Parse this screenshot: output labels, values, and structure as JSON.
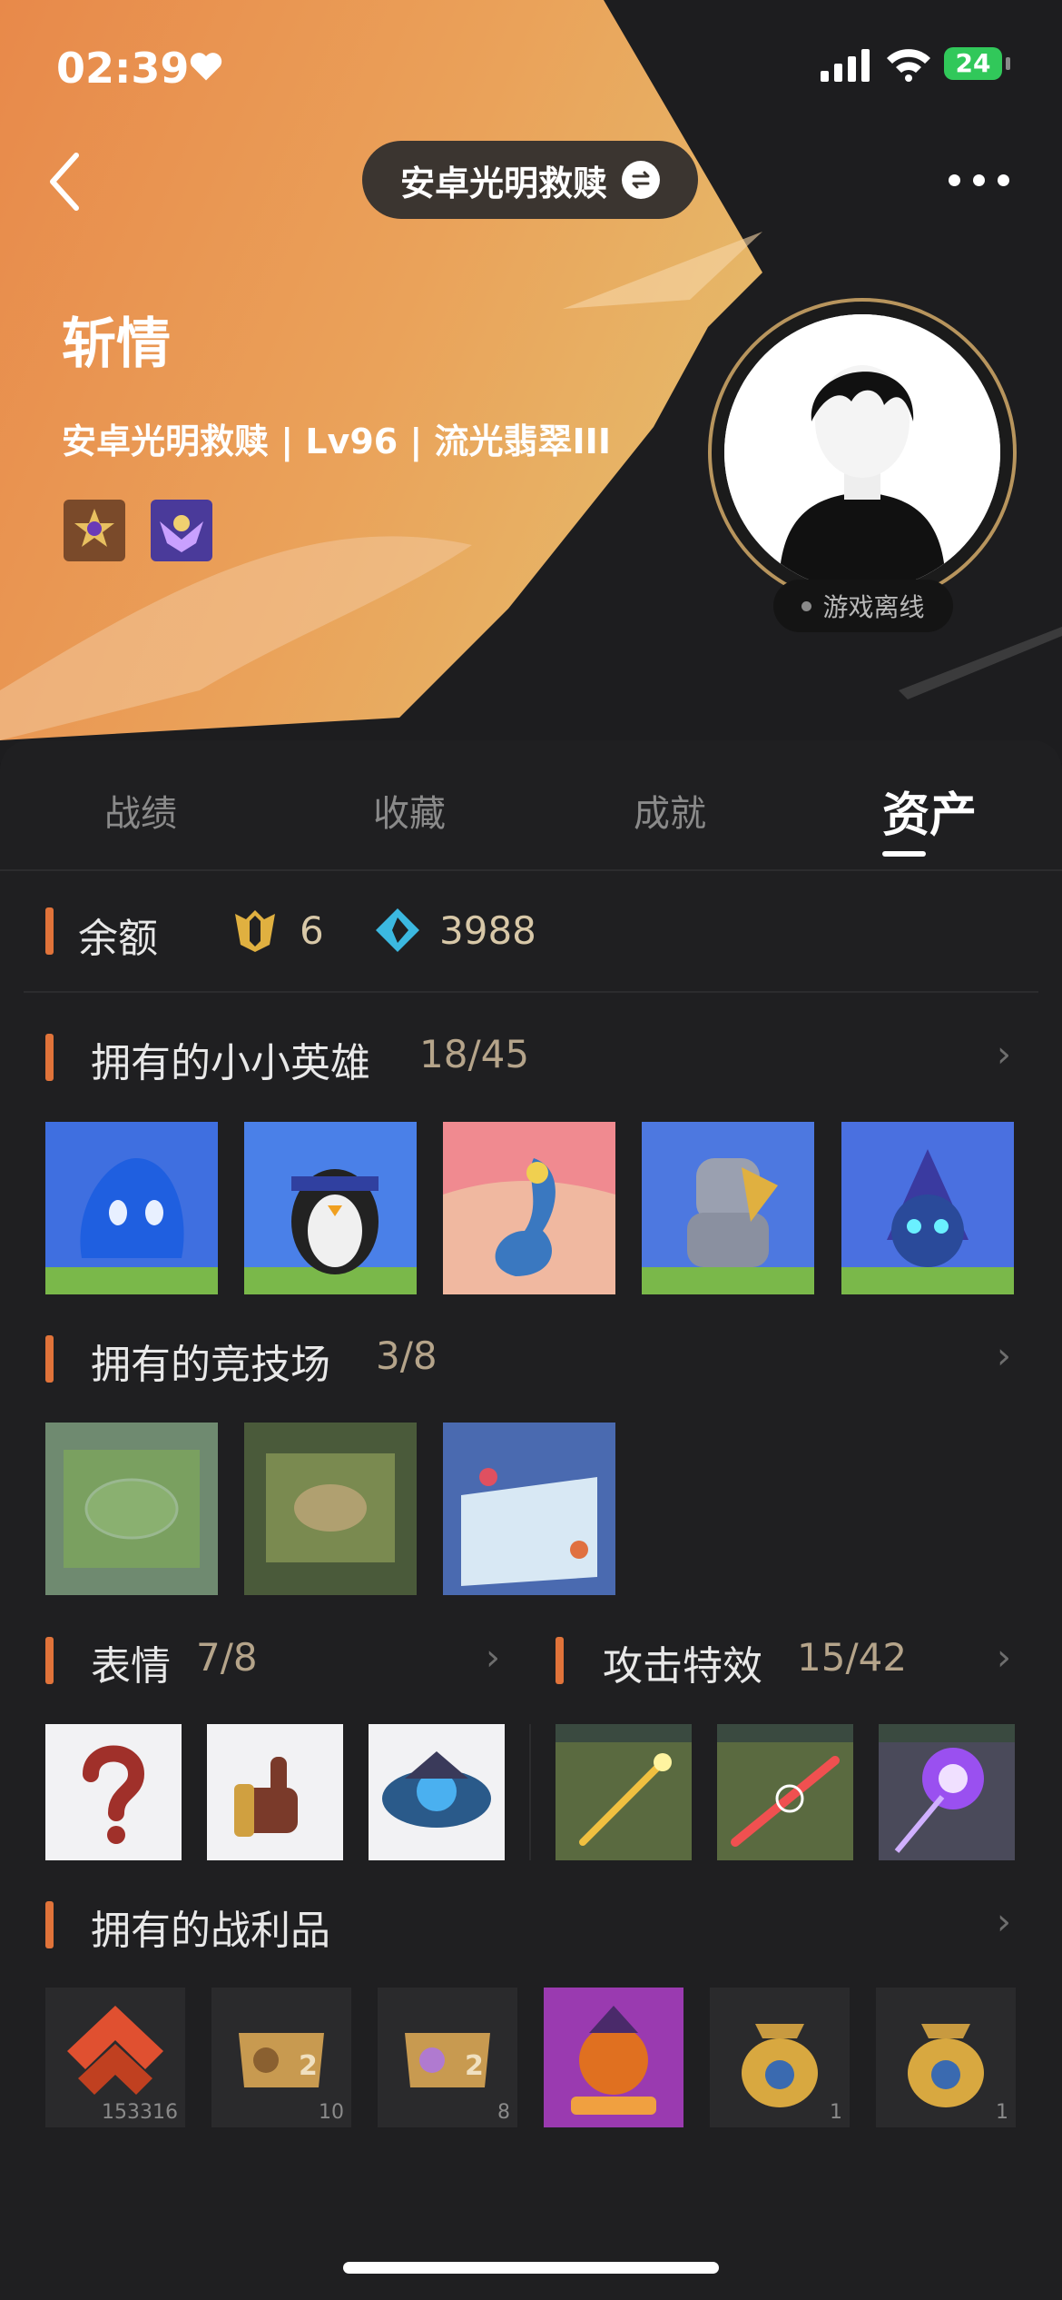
{
  "status": {
    "time": "02:39",
    "battery": "24"
  },
  "header": {
    "server_name": "安卓光明救赎",
    "player_name": "斩情",
    "player_info": "安卓光明救赎 | Lv96 | 流光翡翠III",
    "status": "游戏离线"
  },
  "tabs": [
    {
      "label": "战绩"
    },
    {
      "label": "收藏"
    },
    {
      "label": "成就"
    },
    {
      "label": "资产",
      "active": true
    }
  ],
  "balance": {
    "label": "余额",
    "gold": "6",
    "gems": "3988"
  },
  "sections": {
    "little_legends": {
      "title": "拥有的小小英雄",
      "count": "18/45"
    },
    "arenas": {
      "title": "拥有的竞技场",
      "count": "3/8"
    },
    "emotes": {
      "title": "表情",
      "count": "7/8"
    },
    "attack_effects": {
      "title": "攻击特效",
      "count": "15/42"
    },
    "loot": {
      "title": "拥有的战利品"
    }
  },
  "loot_items": [
    {
      "icon": "rank-token-icon",
      "count": "153316"
    },
    {
      "icon": "egg-ticket-icon",
      "count": "10"
    },
    {
      "icon": "egg-ticket-icon",
      "count": "8"
    },
    {
      "icon": "pumpkin-legend-icon",
      "count": ""
    },
    {
      "icon": "treasure-bag-icon",
      "count": "1"
    },
    {
      "icon": "treasure-bag-icon",
      "count": "1"
    }
  ],
  "colors": {
    "accent": "#e0733a",
    "background": "#1f1f21",
    "count_text": "#b5a48a"
  }
}
